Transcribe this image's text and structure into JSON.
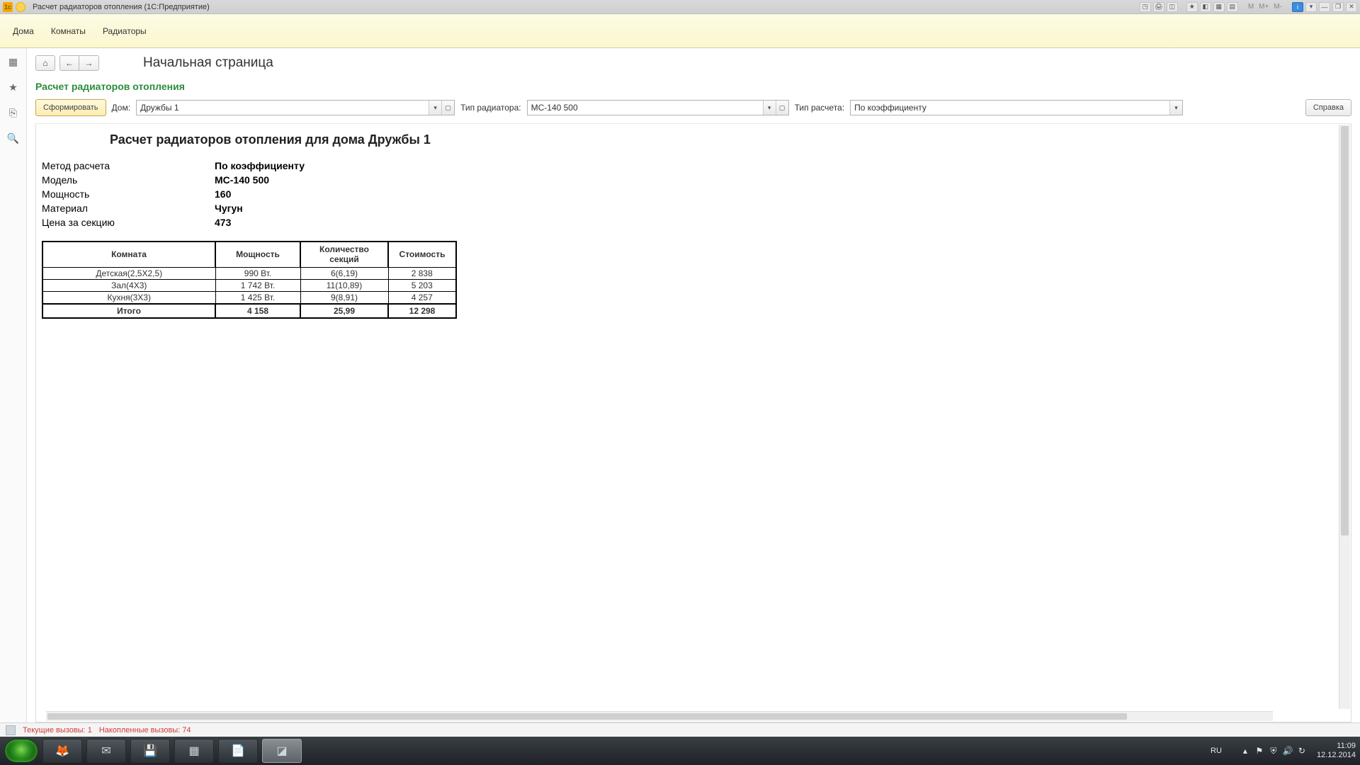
{
  "titlebar": {
    "title": "Расчет радиаторов отопления  (1С:Предприятие)",
    "memory": {
      "m": "M",
      "mplus": "M+",
      "mminus": "M-"
    }
  },
  "menubar": {
    "items": [
      "Дома",
      "Комнаты",
      "Радиаторы"
    ]
  },
  "nav": {
    "page_title": "Начальная страница"
  },
  "section_title": "Расчет радиаторов отопления",
  "toolbar": {
    "generate": "Сформировать",
    "house_label": "Дом:",
    "house_value": "Дружбы 1",
    "type_label": "Тип радиатора:",
    "type_value": "МС-140 500",
    "calc_label": "Тип расчета:",
    "calc_value": "По коэффициенту",
    "help": "Справка"
  },
  "report": {
    "title": "Расчет радиаторов отопления для дома Дружбы 1",
    "meta": [
      {
        "k": "Метод расчета",
        "v": "По коэффициенту"
      },
      {
        "k": "Модель",
        "v": "МС-140 500"
      },
      {
        "k": "Мощность",
        "v": "160"
      },
      {
        "k": "Материал",
        "v": "Чугун"
      },
      {
        "k": "Цена за секцию",
        "v": "473"
      }
    ],
    "columns": [
      "Комната",
      "Мощность",
      "Количество секций",
      "Стоимость"
    ],
    "rows": [
      {
        "room": "Детская(2,5Х2,5)",
        "power": "990 Вт.",
        "sections": "6(6,19)",
        "cost": "2 838"
      },
      {
        "room": "Зал(4Х3)",
        "power": "1 742 Вт.",
        "sections": "11(10,89)",
        "cost": "5 203"
      },
      {
        "room": "Кухня(3Х3)",
        "power": "1 425 Вт.",
        "sections": "9(8,91)",
        "cost": "4 257"
      }
    ],
    "total": {
      "label": "Итого",
      "power": "4 158",
      "sections": "25,99",
      "cost": "12 298"
    }
  },
  "statusbar": {
    "current_calls_label": "Текущие вызовы:",
    "current_calls_value": "1",
    "acc_calls_label": "Накопленные вызовы:",
    "acc_calls_value": "74"
  },
  "taskbar": {
    "lang": "RU",
    "time": "11:09",
    "date": "12.12.2014"
  }
}
